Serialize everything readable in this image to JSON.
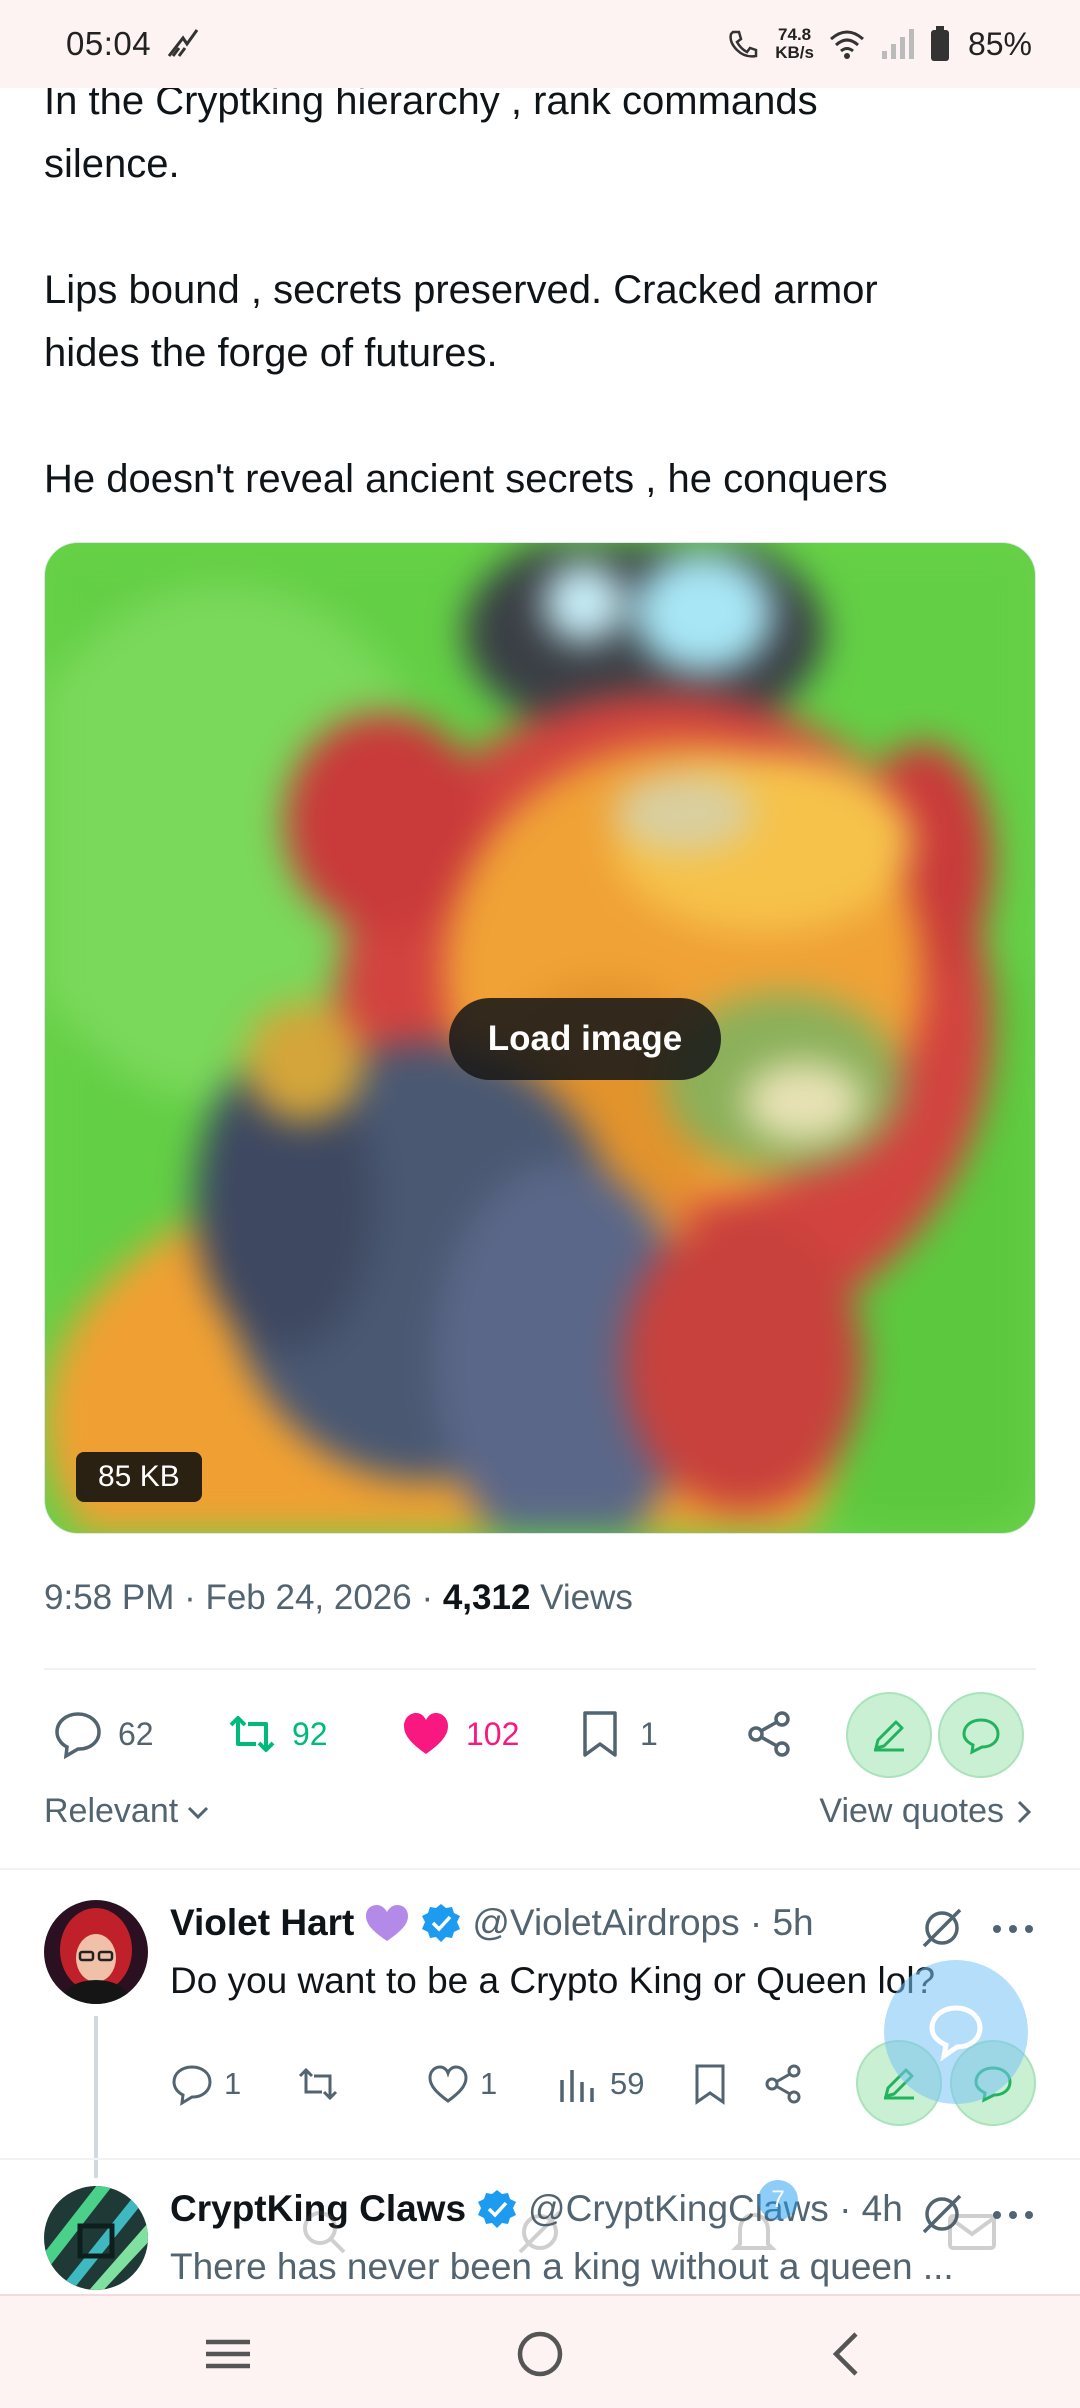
{
  "status_bar": {
    "time": "05:04",
    "net_speed_value": "74.8",
    "net_speed_unit": "KB/s",
    "battery": "85%",
    "icons": [
      "signal-activity-icon",
      "wifi-calling-icon",
      "wifi-icon",
      "cell-signal-icon",
      "battery-icon"
    ]
  },
  "post": {
    "text_lines": {
      "p1_line1": "In the Cryptking hierarchy , rank commands",
      "p1_line2": "silence.",
      "p2_line1": "Lips bound , secrets preserved. Cracked armor",
      "p2_line2": "hides the forge of futures.",
      "p3_line1": "He doesn't reveal ancient secrets , he conquers"
    },
    "media": {
      "load_label": "Load image",
      "size_label": "85 KB"
    },
    "timestamp": "9:58 PM · Feb 24, 2026 · ",
    "views_count": "4,312",
    "views_label": " Views",
    "stats": {
      "replies": "62",
      "reposts": "92",
      "likes": "102",
      "bookmarks": "1"
    },
    "colors": {
      "repost": "#00ba7c",
      "like": "#f91880",
      "accent": "#1d9bf0"
    }
  },
  "sort": {
    "left_label": "Relevant",
    "right_label": "View quotes"
  },
  "replies": [
    {
      "name": "Violet Hart",
      "handle": "@VioletAirdrops · 5h",
      "text": "Do you want to be a Crypto King or Queen lol?",
      "stats": {
        "replies": "1",
        "reposts": "",
        "likes": "1",
        "views": "59"
      }
    },
    {
      "name": "CryptKing Claws",
      "handle": "@CryptKingClaws · 4h",
      "text": "There has never been a king without a queen ..."
    }
  ],
  "ghost_tabs": {
    "badge": "7"
  }
}
